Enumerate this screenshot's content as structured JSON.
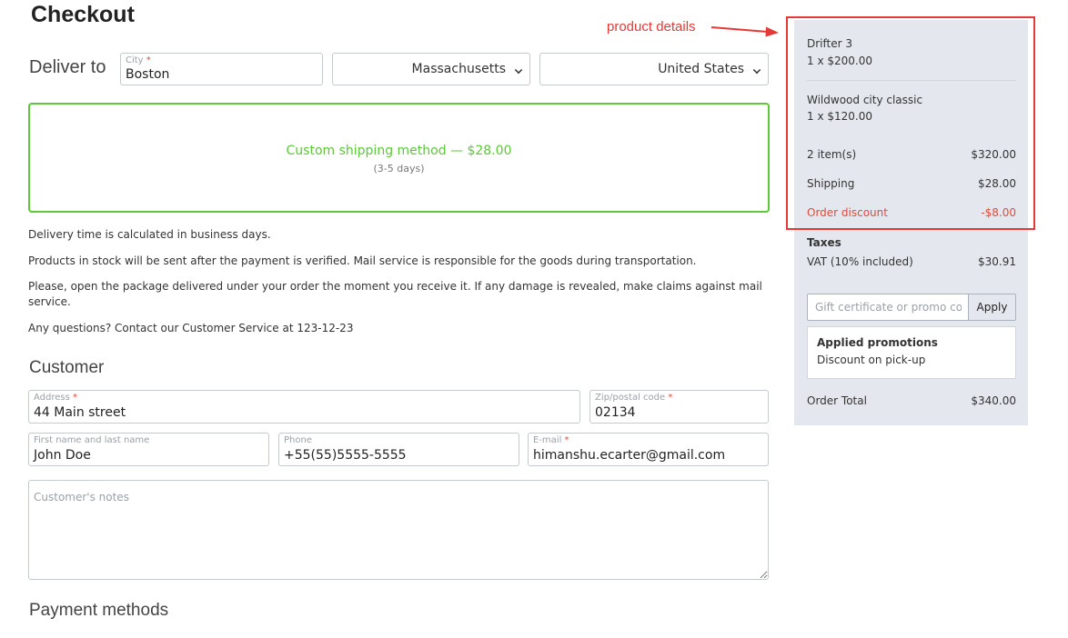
{
  "page": {
    "title": "Checkout"
  },
  "deliver_to": {
    "label": "Deliver to",
    "city_label": "City",
    "city_value": "Boston",
    "state_value": "Massachusetts",
    "country_value": "United States"
  },
  "shipping": {
    "method_label": "Custom shipping method — $28.00",
    "days": "(3-5 days)"
  },
  "info": [
    "Delivery time is calculated in business days.",
    "Products in stock will be sent after the payment is verified. Mail service is responsible for the goods during transportation.",
    "Please, open the package delivered under your order the moment you receive it. If any damage is revealed, make claims against mail service.",
    "Any questions? Contact our Customer Service at 123-12-23"
  ],
  "customer": {
    "title": "Customer",
    "address_label": "Address",
    "address_value": "44 Main street",
    "zip_label": "Zip/postal code",
    "zip_value": "02134",
    "name_label": "First name and last name",
    "name_value": "John Doe",
    "phone_label": "Phone",
    "phone_value": "+55(55)5555-5555",
    "email_label": "E-mail",
    "email_value": "himanshu.ecarter@gmail.com",
    "notes_placeholder": "Customer's notes"
  },
  "payment": {
    "title": "Payment methods"
  },
  "summary": {
    "products": [
      {
        "name": "Drifter 3",
        "qty_price": "1 x $200.00"
      },
      {
        "name": "Wildwood city classic",
        "qty_price": "1 x $120.00"
      }
    ],
    "items_label": "2 item(s)",
    "items_value": "$320.00",
    "shipping_label": "Shipping",
    "shipping_value": "$28.00",
    "discount_label": "Order discount",
    "discount_value": "-$8.00",
    "taxes_title": "Taxes",
    "vat_label": "VAT (10% included)",
    "vat_value": "$30.91",
    "promo_placeholder": "Gift certificate or promo code",
    "apply_label": "Apply",
    "promotions_title": "Applied promotions",
    "promotion_name": "Discount on pick-up",
    "total_label": "Order Total",
    "total_value": "$340.00"
  },
  "annotation": {
    "text": "product details"
  },
  "colors": {
    "accent_green": "#5cc83a",
    "discount_red": "#e14a3a",
    "annotation_red": "#e53935",
    "sidebar_bg": "#e4e8ee"
  }
}
